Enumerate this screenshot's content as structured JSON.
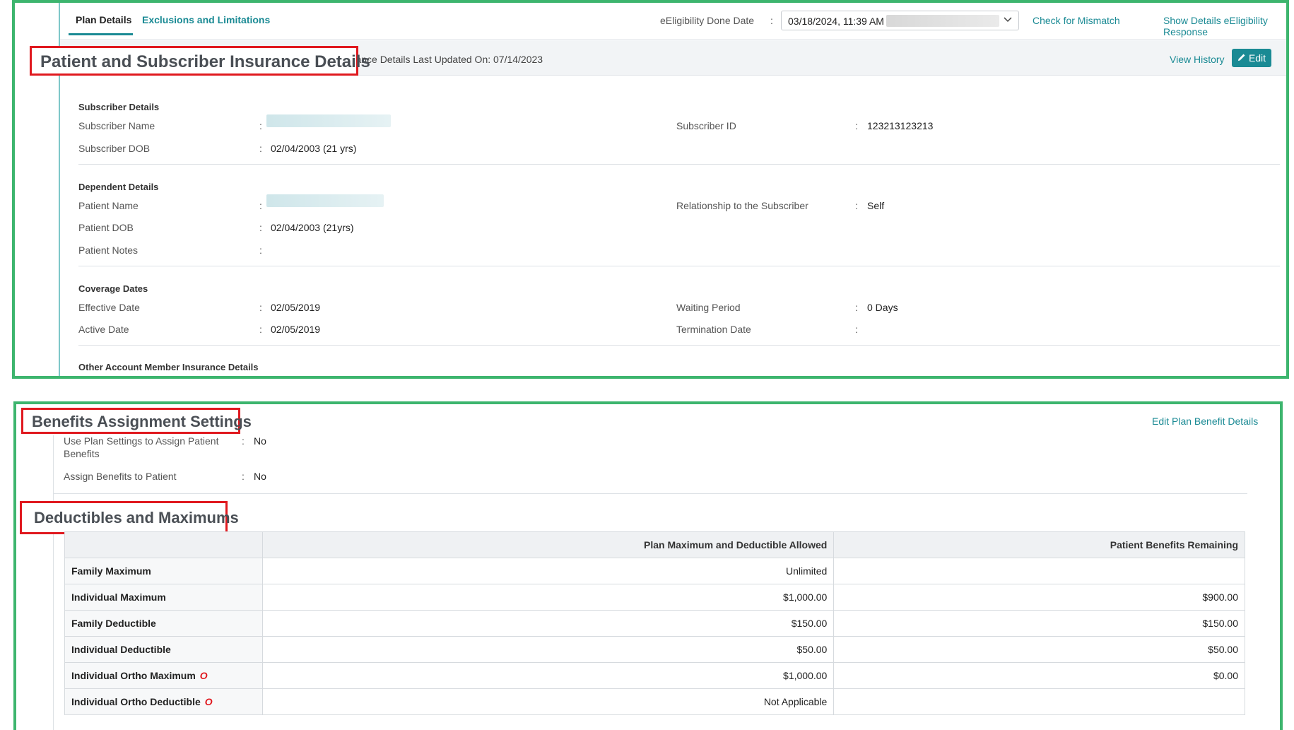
{
  "tabs": {
    "plan_details": "Plan Details",
    "exclusions": "Exclusions and Limitations"
  },
  "eligibility": {
    "label": "eEligibility Done Date",
    "colon": ":",
    "selected_value": "03/18/2024, 11:39 AM",
    "check_mismatch": "Check for Mismatch",
    "show_details": "Show Details eEligibility Response"
  },
  "insurance_section": {
    "title": "Patient and Subscriber Insurance Details",
    "updated_text": "urance Details Last Updated On: 07/14/2023",
    "view_history": "View History",
    "edit_label": "Edit",
    "edit_icon": "pencil-icon"
  },
  "subscriber": {
    "title": "Subscriber Details",
    "name_label": "Subscriber Name",
    "dob_label": "Subscriber DOB",
    "dob_value": "02/04/2003 (21 yrs)",
    "id_label": "Subscriber ID",
    "id_value": "123213123213"
  },
  "dependent": {
    "title": "Dependent Details",
    "patient_name_label": "Patient Name",
    "patient_dob_label": "Patient DOB",
    "patient_dob_value": "02/04/2003 (21yrs)",
    "patient_notes_label": "Patient Notes",
    "relationship_label": "Relationship to the Subscriber",
    "relationship_value": "Self"
  },
  "coverage": {
    "title": "Coverage Dates",
    "effective_label": "Effective Date",
    "effective_value": "02/05/2019",
    "active_label": "Active Date",
    "active_value": "02/05/2019",
    "waiting_label": "Waiting Period",
    "waiting_value": "0 Days",
    "termination_label": "Termination Date"
  },
  "other_account": {
    "title": "Other Account Member Insurance Details"
  },
  "benefits": {
    "title": "Benefits Assignment Settings",
    "edit_link": "Edit Plan Benefit Details",
    "use_plan_label_line1": "Use Plan Settings to Assign Patient",
    "use_plan_label_line2": "Benefits",
    "use_plan_value": "No",
    "assign_label": "Assign Benefits to Patient",
    "assign_value": "No"
  },
  "deductibles": {
    "title": "Deductibles and Maximums",
    "headers": [
      "",
      "Plan Maximum and Deductible Allowed",
      "Patient Benefits Remaining"
    ],
    "rows": [
      {
        "label": "Family Maximum",
        "allowed": "Unlimited",
        "remaining": "",
        "ortho": false
      },
      {
        "label": "Individual Maximum",
        "allowed": "$1,000.00",
        "remaining": "$900.00",
        "ortho": false
      },
      {
        "label": "Family Deductible",
        "allowed": "$150.00",
        "remaining": "$150.00",
        "ortho": false
      },
      {
        "label": "Individual Deductible",
        "allowed": "$50.00",
        "remaining": "$50.00",
        "ortho": false
      },
      {
        "label": "Individual Ortho Maximum",
        "allowed": "$1,000.00",
        "remaining": "$0.00",
        "ortho": true
      },
      {
        "label": "Individual Ortho Deductible",
        "allowed": "Not Applicable",
        "remaining": "",
        "ortho": true
      }
    ],
    "ortho_glyph": "O"
  },
  "colors": {
    "accent": "#1a8a94",
    "highlight_border": "#3db56e",
    "annotation_red": "#e0191f"
  }
}
